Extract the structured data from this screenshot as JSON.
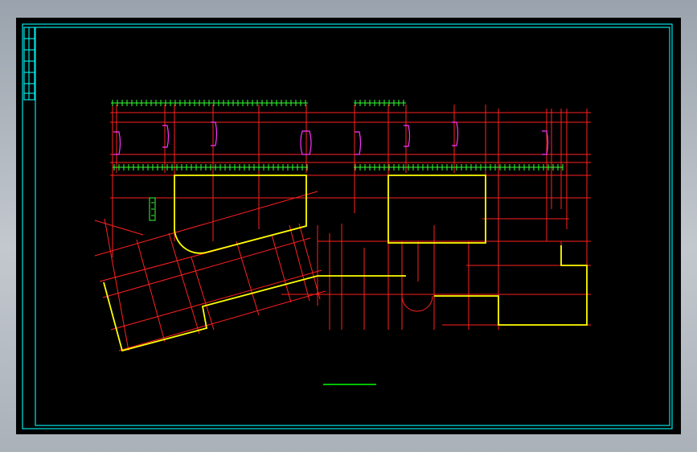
{
  "drawing": {
    "colors": {
      "background": "#000000",
      "frame": "#00e5e5",
      "grid": "#ff2020",
      "outline": "#ffff00",
      "annotation": "#33ff33",
      "fixture": "#ff33ff",
      "scalebar": "#00ff00"
    },
    "layers": [
      {
        "name": "frame",
        "icon": "title-block-frame"
      },
      {
        "name": "grid",
        "icon": "axis-grid-lines"
      },
      {
        "name": "outline",
        "icon": "building-outline"
      },
      {
        "name": "annotation",
        "icon": "dimension-ticks"
      },
      {
        "name": "fixture",
        "icon": "door-symbol"
      }
    ]
  }
}
